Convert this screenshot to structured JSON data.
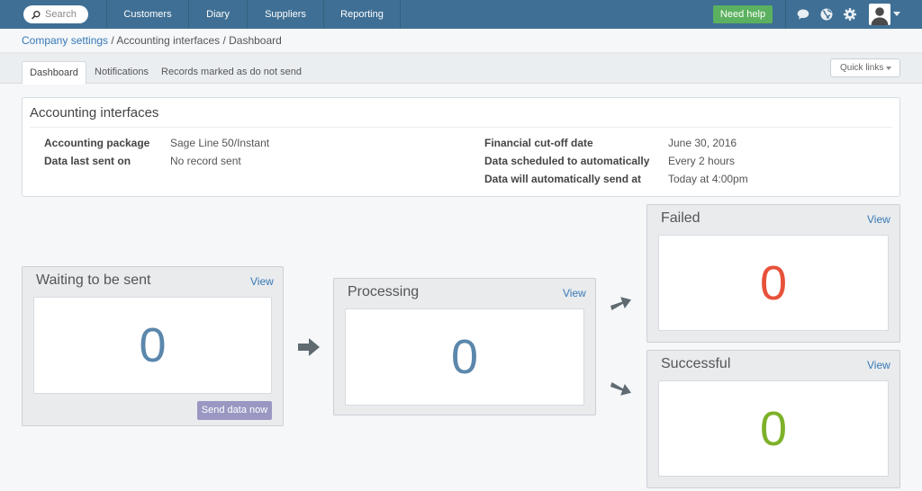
{
  "nav": {
    "search_placeholder": "Search",
    "items": [
      "Customers",
      "Diary",
      "Suppliers",
      "Reporting"
    ],
    "help_label": "Need help",
    "icons": [
      "chat-icon",
      "globe-icon",
      "gear-icon",
      "user-avatar-icon"
    ],
    "colors": {
      "bar": "#3f6f94",
      "help": "#5bb15f"
    }
  },
  "breadcrumb": {
    "root": "Company settings",
    "rest": " / Accounting interfaces / Dashboard"
  },
  "tabs": [
    "Dashboard",
    "Notifications",
    "Records marked as do not send"
  ],
  "quick_links": "Quick links",
  "accounting": {
    "title": "Accounting interfaces",
    "left": [
      {
        "label": "Accounting package",
        "value": "Sage Line 50/Instant"
      },
      {
        "label": "Data last sent on",
        "value": "No record sent"
      }
    ],
    "right": [
      {
        "label": "Financial cut-off date",
        "value": "June 30, 2016"
      },
      {
        "label": "Data scheduled to automatically",
        "value": "Every 2 hours"
      },
      {
        "label": "Data will automatically send at",
        "value": "Today at 4:00pm"
      }
    ]
  },
  "stats": {
    "waiting": {
      "title": "Waiting to be sent",
      "view": "View",
      "count": "0",
      "color": "#5b87ac",
      "button": "Send data now"
    },
    "processing": {
      "title": "Processing",
      "view": "View",
      "count": "0",
      "color": "#5b87ac"
    },
    "failed": {
      "title": "Failed",
      "view": "View",
      "count": "0",
      "color": "#e8513a"
    },
    "successful": {
      "title": "Successful",
      "view": "View",
      "count": "0",
      "color": "#7eb12a"
    }
  }
}
